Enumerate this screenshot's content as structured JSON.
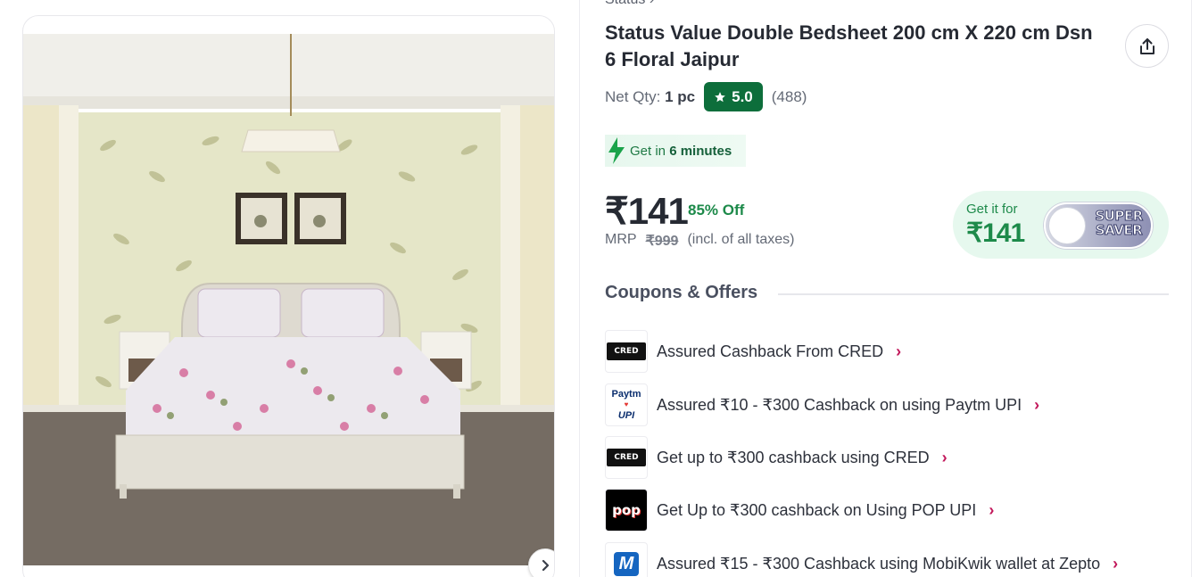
{
  "breadcrumb": {
    "label": "Status",
    "separator": "›"
  },
  "product": {
    "title": "Status Value Double Bedsheet 200 cm X 220 cm Dsn 6 Floral Jaipur",
    "qty_label": "Net Qty:",
    "qty_value": "1 pc",
    "rating": "5.0",
    "rating_count": "(488)"
  },
  "delivery": {
    "prefix": "Get in",
    "time": "6 minutes"
  },
  "pricing": {
    "price": "₹141",
    "discount": "85% Off",
    "mrp_label": "MRP",
    "mrp_value": "₹999",
    "tax_note": "(incl. of all taxes)"
  },
  "super_saver": {
    "get_it_for": "Get it for",
    "price": "₹141",
    "toggle_label_1": "SUPER",
    "toggle_label_2": "SAVER"
  },
  "coupons": {
    "heading": "Coupons & Offers",
    "items": [
      {
        "logo": "cred-logo",
        "text": "Assured Cashback From CRED"
      },
      {
        "logo": "paytm-upi-logo",
        "text": "Assured ₹10 - ₹300 Cashback on using Paytm UPI"
      },
      {
        "logo": "cred-logo",
        "text": "Get up to ₹300 cashback using CRED"
      },
      {
        "logo": "pop-logo",
        "text": "Get Up to ₹300 cashback on Using POP UPI"
      },
      {
        "logo": "mobikwik-logo",
        "text": "Assured ₹15 - ₹300 Cashback using MobiKwik wallet at Zepto"
      }
    ]
  },
  "logos": {
    "cred": "CRED",
    "paytm": "Paytm",
    "upi": "UPI",
    "pop": "pop",
    "mobikwik": "M"
  },
  "colors": {
    "accent_green": "#0d6e3b",
    "offer_green": "#1d8a4a",
    "chevron": "#c2185b"
  },
  "icons": {
    "share": "share-icon",
    "next": "chevron-right-icon",
    "star": "star-icon",
    "bolt": "lightning-icon"
  }
}
